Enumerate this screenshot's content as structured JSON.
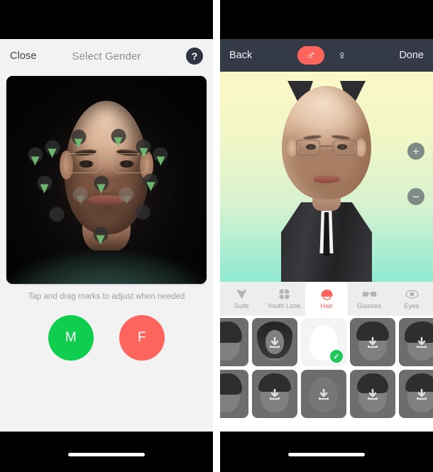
{
  "left_phone": {
    "nav": {
      "close_label": "Close",
      "title": "Select Gender",
      "help_label": "?"
    },
    "photo": {
      "alt": "face-photo-with-landmarks",
      "markers_count": 13
    },
    "hint": "Tap and drag marks to adjust when needed",
    "gender_buttons": [
      {
        "label": "M",
        "name": "male",
        "color": "#0fce4e"
      },
      {
        "label": "F",
        "name": "female",
        "color": "#fd655c"
      }
    ]
  },
  "right_phone": {
    "nav": {
      "back_label": "Back",
      "done_label": "Done",
      "gender_toggle": [
        {
          "symbol": "♂",
          "name": "male",
          "active": true
        },
        {
          "symbol": "♀",
          "name": "female",
          "active": false
        }
      ]
    },
    "canvas": {
      "zoom_in_label": "+",
      "zoom_out_label": "−"
    },
    "tabs": [
      {
        "label": "Suits",
        "icon": "suit-icon",
        "active": false
      },
      {
        "label": "Youth Look",
        "icon": "clover-icon",
        "active": false
      },
      {
        "label": "Hair",
        "icon": "hair-icon",
        "active": true
      },
      {
        "label": "Glasses",
        "icon": "glasses-icon",
        "active": false
      },
      {
        "label": "Eyes",
        "icon": "eye-icon",
        "active": false
      }
    ],
    "thumbnail_rows": [
      [
        {
          "style": "h-side",
          "selected": false,
          "downloadable": true
        },
        {
          "style": "h-long",
          "selected": false,
          "downloadable": true
        },
        {
          "style": "h-none",
          "selected": true,
          "downloadable": false
        },
        {
          "style": "h-spiky",
          "selected": false,
          "downloadable": true
        },
        {
          "style": "h-wavy",
          "selected": false,
          "downloadable": true
        }
      ],
      [
        {
          "style": "h-side",
          "selected": false,
          "downloadable": true
        },
        {
          "style": "h-bowl",
          "selected": false,
          "downloadable": true
        },
        {
          "style": "h-none",
          "selected": false,
          "downloadable": true
        },
        {
          "style": "h-short",
          "selected": false,
          "downloadable": true
        },
        {
          "style": "h-bowl",
          "selected": false,
          "downloadable": true
        }
      ]
    ]
  },
  "theme": {
    "accent_red": "#fd655c",
    "accent_green": "#0fce4e",
    "nav_dark": "#343a47",
    "check_green": "#1ec85a"
  }
}
